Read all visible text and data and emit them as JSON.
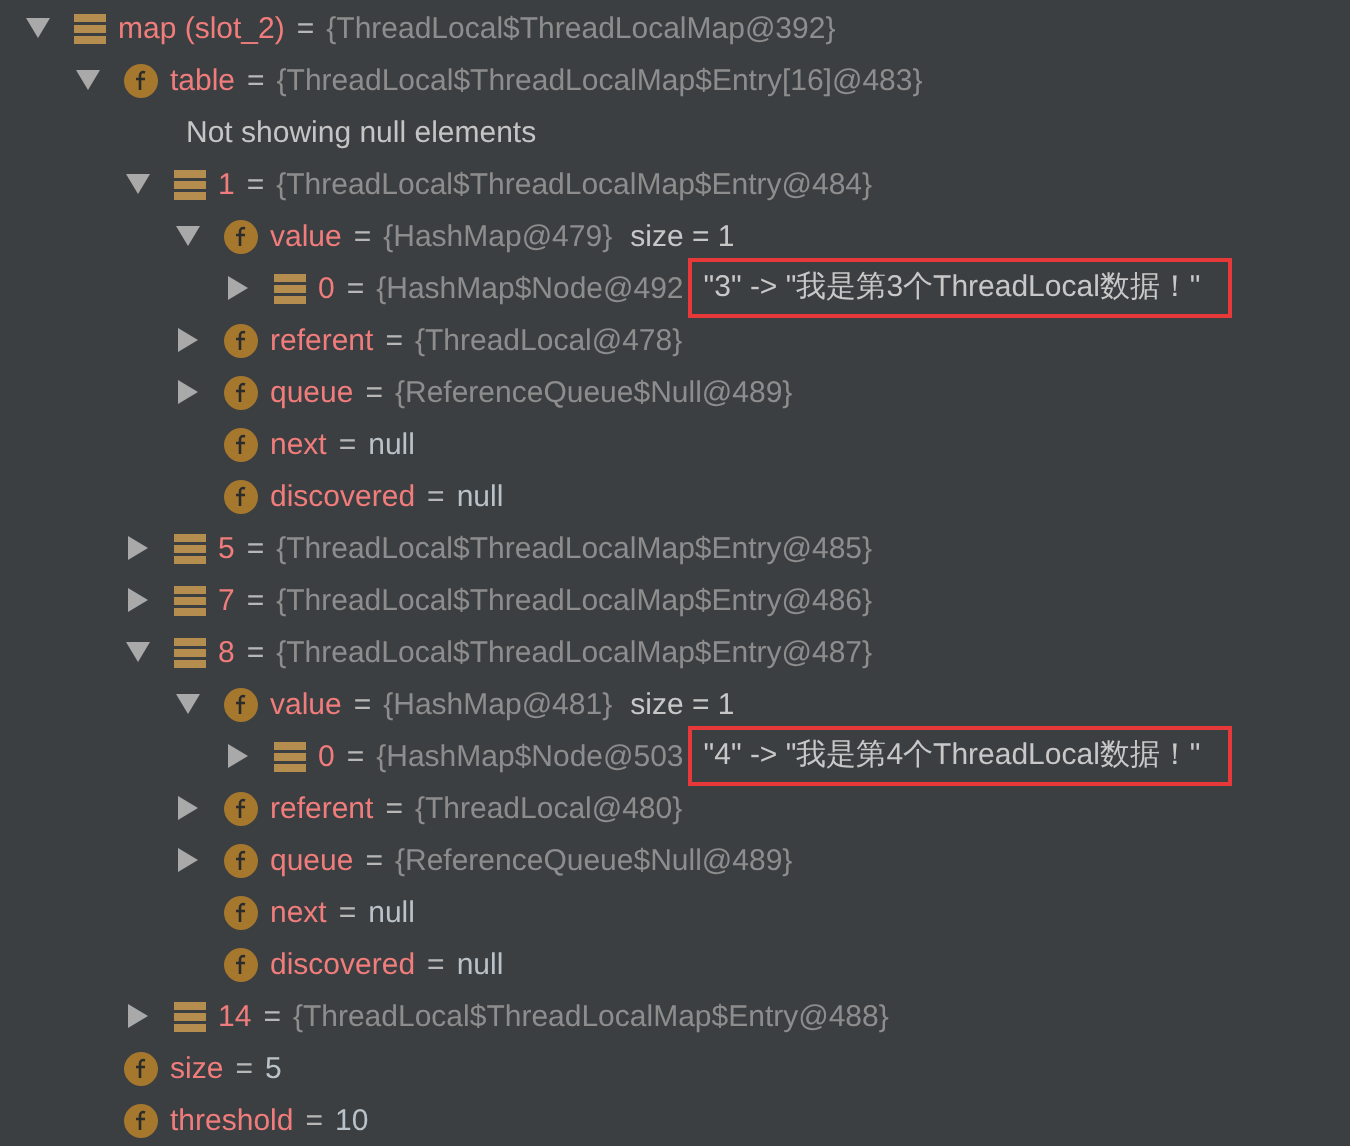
{
  "tree": [
    {
      "kind": "array",
      "name": "map (slot_2)",
      "sep": "=",
      "value": "{ThreadLocal$ThreadLocalMap@392}",
      "plain": false,
      "expanded": true,
      "children": [
        {
          "kind": "field",
          "name": "table",
          "sep": "=",
          "value": "{ThreadLocal$ThreadLocalMap$Entry[16]@483}",
          "plain": false,
          "expanded": true,
          "children": [
            {
              "kind": "note",
              "text": "Not showing null elements"
            },
            {
              "kind": "array",
              "name": "1",
              "sep": "=",
              "value": "{ThreadLocal$ThreadLocalMap$Entry@484}",
              "plain": false,
              "expanded": true,
              "children": [
                {
                  "kind": "field",
                  "name": "value",
                  "sep": "=",
                  "value": "{HashMap@479}",
                  "plain": false,
                  "extra": "size = 1",
                  "expanded": true,
                  "children": [
                    {
                      "kind": "array",
                      "name": "0",
                      "sep": "=",
                      "value": "{HashMap$Node@492",
                      "plain": false,
                      "expanded": false,
                      "highlight": "\"3\" -> \"我是第3个ThreadLocal数据！\""
                    }
                  ]
                },
                {
                  "kind": "field",
                  "name": "referent",
                  "sep": "=",
                  "value": "{ThreadLocal@478}",
                  "plain": false,
                  "expanded": false
                },
                {
                  "kind": "field",
                  "name": "queue",
                  "sep": "=",
                  "value": "{ReferenceQueue$Null@489}",
                  "plain": false,
                  "expanded": false
                },
                {
                  "kind": "field",
                  "name": "next",
                  "sep": "=",
                  "value": "null",
                  "plain": true
                },
                {
                  "kind": "field",
                  "name": "discovered",
                  "sep": "=",
                  "value": "null",
                  "plain": true
                }
              ]
            },
            {
              "kind": "array",
              "name": "5",
              "sep": "=",
              "value": "{ThreadLocal$ThreadLocalMap$Entry@485}",
              "plain": false,
              "expanded": false
            },
            {
              "kind": "array",
              "name": "7",
              "sep": "=",
              "value": "{ThreadLocal$ThreadLocalMap$Entry@486}",
              "plain": false,
              "expanded": false
            },
            {
              "kind": "array",
              "name": "8",
              "sep": "=",
              "value": "{ThreadLocal$ThreadLocalMap$Entry@487}",
              "plain": false,
              "expanded": true,
              "children": [
                {
                  "kind": "field",
                  "name": "value",
                  "sep": "=",
                  "value": "{HashMap@481}",
                  "plain": false,
                  "extra": "size = 1",
                  "expanded": true,
                  "children": [
                    {
                      "kind": "array",
                      "name": "0",
                      "sep": "=",
                      "value": "{HashMap$Node@503",
                      "plain": false,
                      "expanded": false,
                      "highlight": "\"4\" -> \"我是第4个ThreadLocal数据！\""
                    }
                  ]
                },
                {
                  "kind": "field",
                  "name": "referent",
                  "sep": "=",
                  "value": "{ThreadLocal@480}",
                  "plain": false,
                  "expanded": false
                },
                {
                  "kind": "field",
                  "name": "queue",
                  "sep": "=",
                  "value": "{ReferenceQueue$Null@489}",
                  "plain": false,
                  "expanded": false
                },
                {
                  "kind": "field",
                  "name": "next",
                  "sep": "=",
                  "value": "null",
                  "plain": true
                },
                {
                  "kind": "field",
                  "name": "discovered",
                  "sep": "=",
                  "value": "null",
                  "plain": true
                }
              ]
            },
            {
              "kind": "array",
              "name": "14",
              "sep": "=",
              "value": "{ThreadLocal$ThreadLocalMap$Entry@488}",
              "plain": false,
              "expanded": false
            }
          ]
        },
        {
          "kind": "field",
          "name": "size",
          "sep": "=",
          "value": "5",
          "plain": true
        },
        {
          "kind": "field",
          "name": "threshold",
          "sep": "=",
          "value": "10",
          "plain": true
        }
      ]
    }
  ]
}
